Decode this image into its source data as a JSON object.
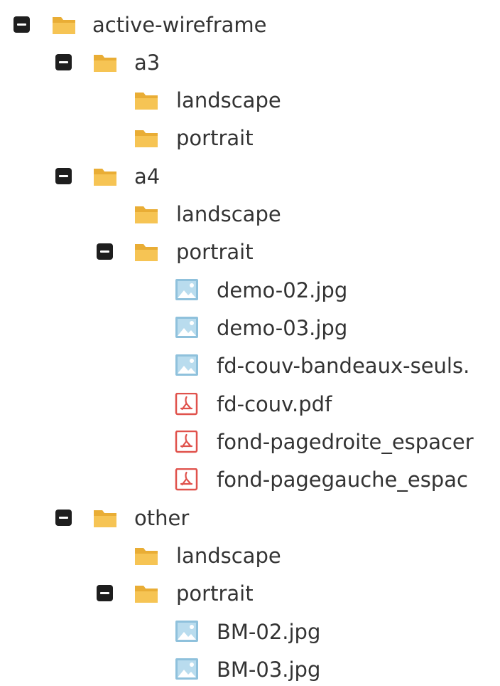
{
  "colors": {
    "folder": "#f6c454",
    "folder_tab": "#e9ad35",
    "image_icon": "#8fc1dc",
    "pdf_icon": "#e0524c",
    "toggle": "#1e1e1e",
    "text": "#333333"
  },
  "tree": {
    "root": {
      "label": "active-wireframe",
      "state": "expanded",
      "icon": "folder-open-icon",
      "children": {
        "a3": {
          "label": "a3",
          "state": "expanded",
          "icon": "folder-open-icon",
          "children": {
            "landscape": {
              "label": "landscape",
              "icon": "folder-icon"
            },
            "portrait": {
              "label": "portrait",
              "icon": "folder-icon"
            }
          }
        },
        "a4": {
          "label": "a4",
          "state": "expanded",
          "icon": "folder-open-icon",
          "children": {
            "landscape": {
              "label": "landscape",
              "icon": "folder-icon"
            },
            "portrait": {
              "label": "portrait",
              "state": "expanded",
              "icon": "folder-open-icon",
              "files": [
                {
                  "label": "demo-02.jpg",
                  "icon": "image-file-icon"
                },
                {
                  "label": "demo-03.jpg",
                  "icon": "image-file-icon"
                },
                {
                  "label": "fd-couv-bandeaux-seuls.",
                  "icon": "image-file-icon"
                },
                {
                  "label": "fd-couv.pdf",
                  "icon": "pdf-file-icon"
                },
                {
                  "label": "fond-pagedroite_espacer",
                  "icon": "pdf-file-icon"
                },
                {
                  "label": "fond-pagegauche_espac",
                  "icon": "pdf-file-icon"
                }
              ]
            }
          }
        },
        "other": {
          "label": "other",
          "state": "expanded",
          "icon": "folder-open-icon",
          "children": {
            "landscape": {
              "label": "landscape",
              "icon": "folder-icon"
            },
            "portrait": {
              "label": "portrait",
              "state": "expanded",
              "icon": "folder-open-icon",
              "files": [
                {
                  "label": "BM-02.jpg",
                  "icon": "image-file-icon"
                },
                {
                  "label": "BM-03.jpg",
                  "icon": "image-file-icon"
                }
              ]
            }
          }
        }
      }
    }
  }
}
